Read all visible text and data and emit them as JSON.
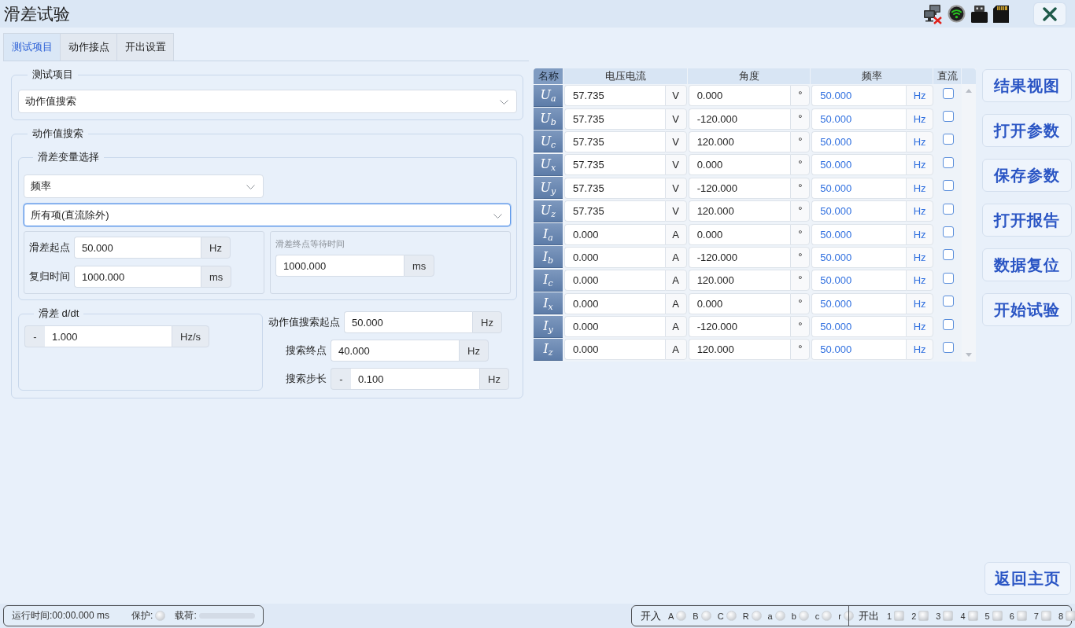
{
  "window": {
    "title": "滑差试验"
  },
  "tabs": [
    {
      "label": "测试项目",
      "selected": true
    },
    {
      "label": "动作接点",
      "selected": false
    },
    {
      "label": "开出设置",
      "selected": false
    }
  ],
  "test_item": {
    "legend": "测试项目",
    "select": {
      "value": "动作值搜索",
      "focused": false
    }
  },
  "search": {
    "legend": "动作值搜索",
    "variable": {
      "legend": "滑差变量选择",
      "variable_select": {
        "value": "频率",
        "focused": false
      },
      "scope_select": {
        "value": "所有项(直流除外)",
        "focused": true
      },
      "start_fields": [
        {
          "label": "滑差起点",
          "value": "50.000",
          "unit": "Hz"
        },
        {
          "label": "复归时间",
          "value": "1000.000",
          "unit": "ms"
        }
      ],
      "wait": {
        "label": "滑差终点等待时间",
        "value": "1000.000",
        "unit": "ms"
      }
    },
    "rate": {
      "legend": "滑差 d/dt",
      "sign": "-",
      "value": "1.000",
      "unit": "Hz/s"
    },
    "search_fields": [
      {
        "label": "动作值搜索起点",
        "value": "50.000",
        "unit": "Hz"
      },
      {
        "label": "搜索终点",
        "value": "40.000",
        "unit": "Hz"
      },
      {
        "label": "搜索步长",
        "sign": "-",
        "value": "0.100",
        "unit": "Hz"
      }
    ]
  },
  "table": {
    "columns": [
      "名称",
      "电压电流",
      "角度",
      "频率",
      "直流"
    ],
    "rows": [
      {
        "name": "U$_{a}$",
        "magnitude": "57.735",
        "magnitude_unit": "V",
        "angle": "0.000",
        "angle_unit": "°",
        "frequency": "50.000",
        "frequency_unit": "Hz",
        "frequency_varied": true,
        "dc": false
      },
      {
        "name": "U$_{b}$",
        "magnitude": "57.735",
        "magnitude_unit": "V",
        "angle": "-120.000",
        "angle_unit": "°",
        "frequency": "50.000",
        "frequency_unit": "Hz",
        "frequency_varied": true,
        "dc": false
      },
      {
        "name": "U$_{c}$",
        "magnitude": "57.735",
        "magnitude_unit": "V",
        "angle": "120.000",
        "angle_unit": "°",
        "frequency": "50.000",
        "frequency_unit": "Hz",
        "frequency_varied": true,
        "dc": false
      },
      {
        "name": "U$_{x}$",
        "magnitude": "57.735",
        "magnitude_unit": "V",
        "angle": "0.000",
        "angle_unit": "°",
        "frequency": "50.000",
        "frequency_unit": "Hz",
        "frequency_varied": true,
        "dc": false
      },
      {
        "name": "U$_{y}$",
        "magnitude": "57.735",
        "magnitude_unit": "V",
        "angle": "-120.000",
        "angle_unit": "°",
        "frequency": "50.000",
        "frequency_unit": "Hz",
        "frequency_varied": true,
        "dc": false
      },
      {
        "name": "U$_{z}$",
        "magnitude": "57.735",
        "magnitude_unit": "V",
        "angle": "120.000",
        "angle_unit": "°",
        "frequency": "50.000",
        "frequency_unit": "Hz",
        "frequency_varied": true,
        "dc": false
      },
      {
        "name": "I$_{a}$",
        "magnitude": "0.000",
        "magnitude_unit": "A",
        "angle": "0.000",
        "angle_unit": "°",
        "frequency": "50.000",
        "frequency_unit": "Hz",
        "frequency_varied": true,
        "dc": false
      },
      {
        "name": "I$_{b}$",
        "magnitude": "0.000",
        "magnitude_unit": "A",
        "angle": "-120.000",
        "angle_unit": "°",
        "frequency": "50.000",
        "frequency_unit": "Hz",
        "frequency_varied": true,
        "dc": false
      },
      {
        "name": "I$_{c}$",
        "magnitude": "0.000",
        "magnitude_unit": "A",
        "angle": "120.000",
        "angle_unit": "°",
        "frequency": "50.000",
        "frequency_unit": "Hz",
        "frequency_varied": true,
        "dc": false
      },
      {
        "name": "I$_{x}$",
        "magnitude": "0.000",
        "magnitude_unit": "A",
        "angle": "0.000",
        "angle_unit": "°",
        "frequency": "50.000",
        "frequency_unit": "Hz",
        "frequency_varied": true,
        "dc": false
      },
      {
        "name": "I$_{y}$",
        "magnitude": "0.000",
        "magnitude_unit": "A",
        "angle": "-120.000",
        "angle_unit": "°",
        "frequency": "50.000",
        "frequency_unit": "Hz",
        "frequency_varied": true,
        "dc": false
      },
      {
        "name": "I$_{z}$",
        "magnitude": "0.000",
        "magnitude_unit": "A",
        "angle": "120.000",
        "angle_unit": "°",
        "frequency": "50.000",
        "frequency_unit": "Hz",
        "frequency_varied": true,
        "dc": false
      }
    ]
  },
  "actions": [
    "结果视图",
    "打开参数",
    "保存参数",
    "打开报告",
    "数据复位",
    "开始试验"
  ],
  "home_button": "返回主页",
  "status_bar": {
    "runtime": "运行时间:00:00.000 ms",
    "protection": {
      "label": "保护:",
      "on": false
    },
    "load": {
      "label": "载荷:",
      "level": 0
    },
    "inputs": {
      "label": "开入",
      "channels": [
        {
          "label": "A",
          "on": false
        },
        {
          "label": "B",
          "on": false
        },
        {
          "label": "C",
          "on": false
        },
        {
          "label": "R",
          "on": false
        },
        {
          "label": "a",
          "on": false
        },
        {
          "label": "b",
          "on": false
        },
        {
          "label": "c",
          "on": false
        },
        {
          "label": "r",
          "on": false
        }
      ]
    },
    "outputs": {
      "label": "开出",
      "channels": [
        {
          "label": "1",
          "on": false
        },
        {
          "label": "2",
          "on": false
        },
        {
          "label": "3",
          "on": false
        },
        {
          "label": "4",
          "on": false
        },
        {
          "label": "5",
          "on": false
        },
        {
          "label": "6",
          "on": false
        },
        {
          "label": "7",
          "on": false
        },
        {
          "label": "8",
          "on": false
        }
      ]
    }
  }
}
